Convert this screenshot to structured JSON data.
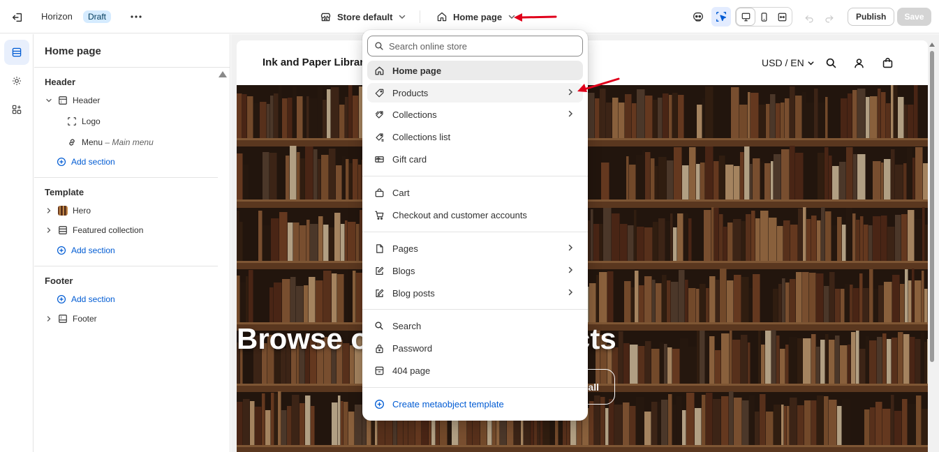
{
  "topbar": {
    "theme_name": "Horizon",
    "draft_badge": "Draft",
    "store_selector": "Store default",
    "page_selector": "Home page",
    "publish_label": "Publish",
    "save_label": "Save"
  },
  "sidebar": {
    "title": "Home page",
    "header_group": "Header",
    "header_section": "Header",
    "logo": "Logo",
    "menu_label": "Menu",
    "menu_sep": " – ",
    "menu_sub": "Main menu",
    "add_section": "Add section",
    "template_group": "Template",
    "hero": "Hero",
    "featured_collection": "Featured collection",
    "footer_group": "Footer",
    "footer_section": "Footer"
  },
  "preview": {
    "store_name": "Ink and Paper Library",
    "currency": "USD / EN",
    "hero_title": "Browse our latest products",
    "hero_cta": "Shop all"
  },
  "dropdown": {
    "search_placeholder": "Search online store",
    "items": [
      {
        "label": "Home page"
      },
      {
        "label": "Products"
      },
      {
        "label": "Collections"
      },
      {
        "label": "Collections list"
      },
      {
        "label": "Gift card"
      },
      {
        "label": "Cart"
      },
      {
        "label": "Checkout and customer accounts"
      },
      {
        "label": "Pages"
      },
      {
        "label": "Blogs"
      },
      {
        "label": "Blog posts"
      },
      {
        "label": "Search"
      },
      {
        "label": "Password"
      },
      {
        "label": "404 page"
      },
      {
        "label": "Create metaobject template"
      }
    ]
  },
  "colors": {
    "accent": "#005bd3",
    "annotation_arrow": "#e0001b"
  }
}
